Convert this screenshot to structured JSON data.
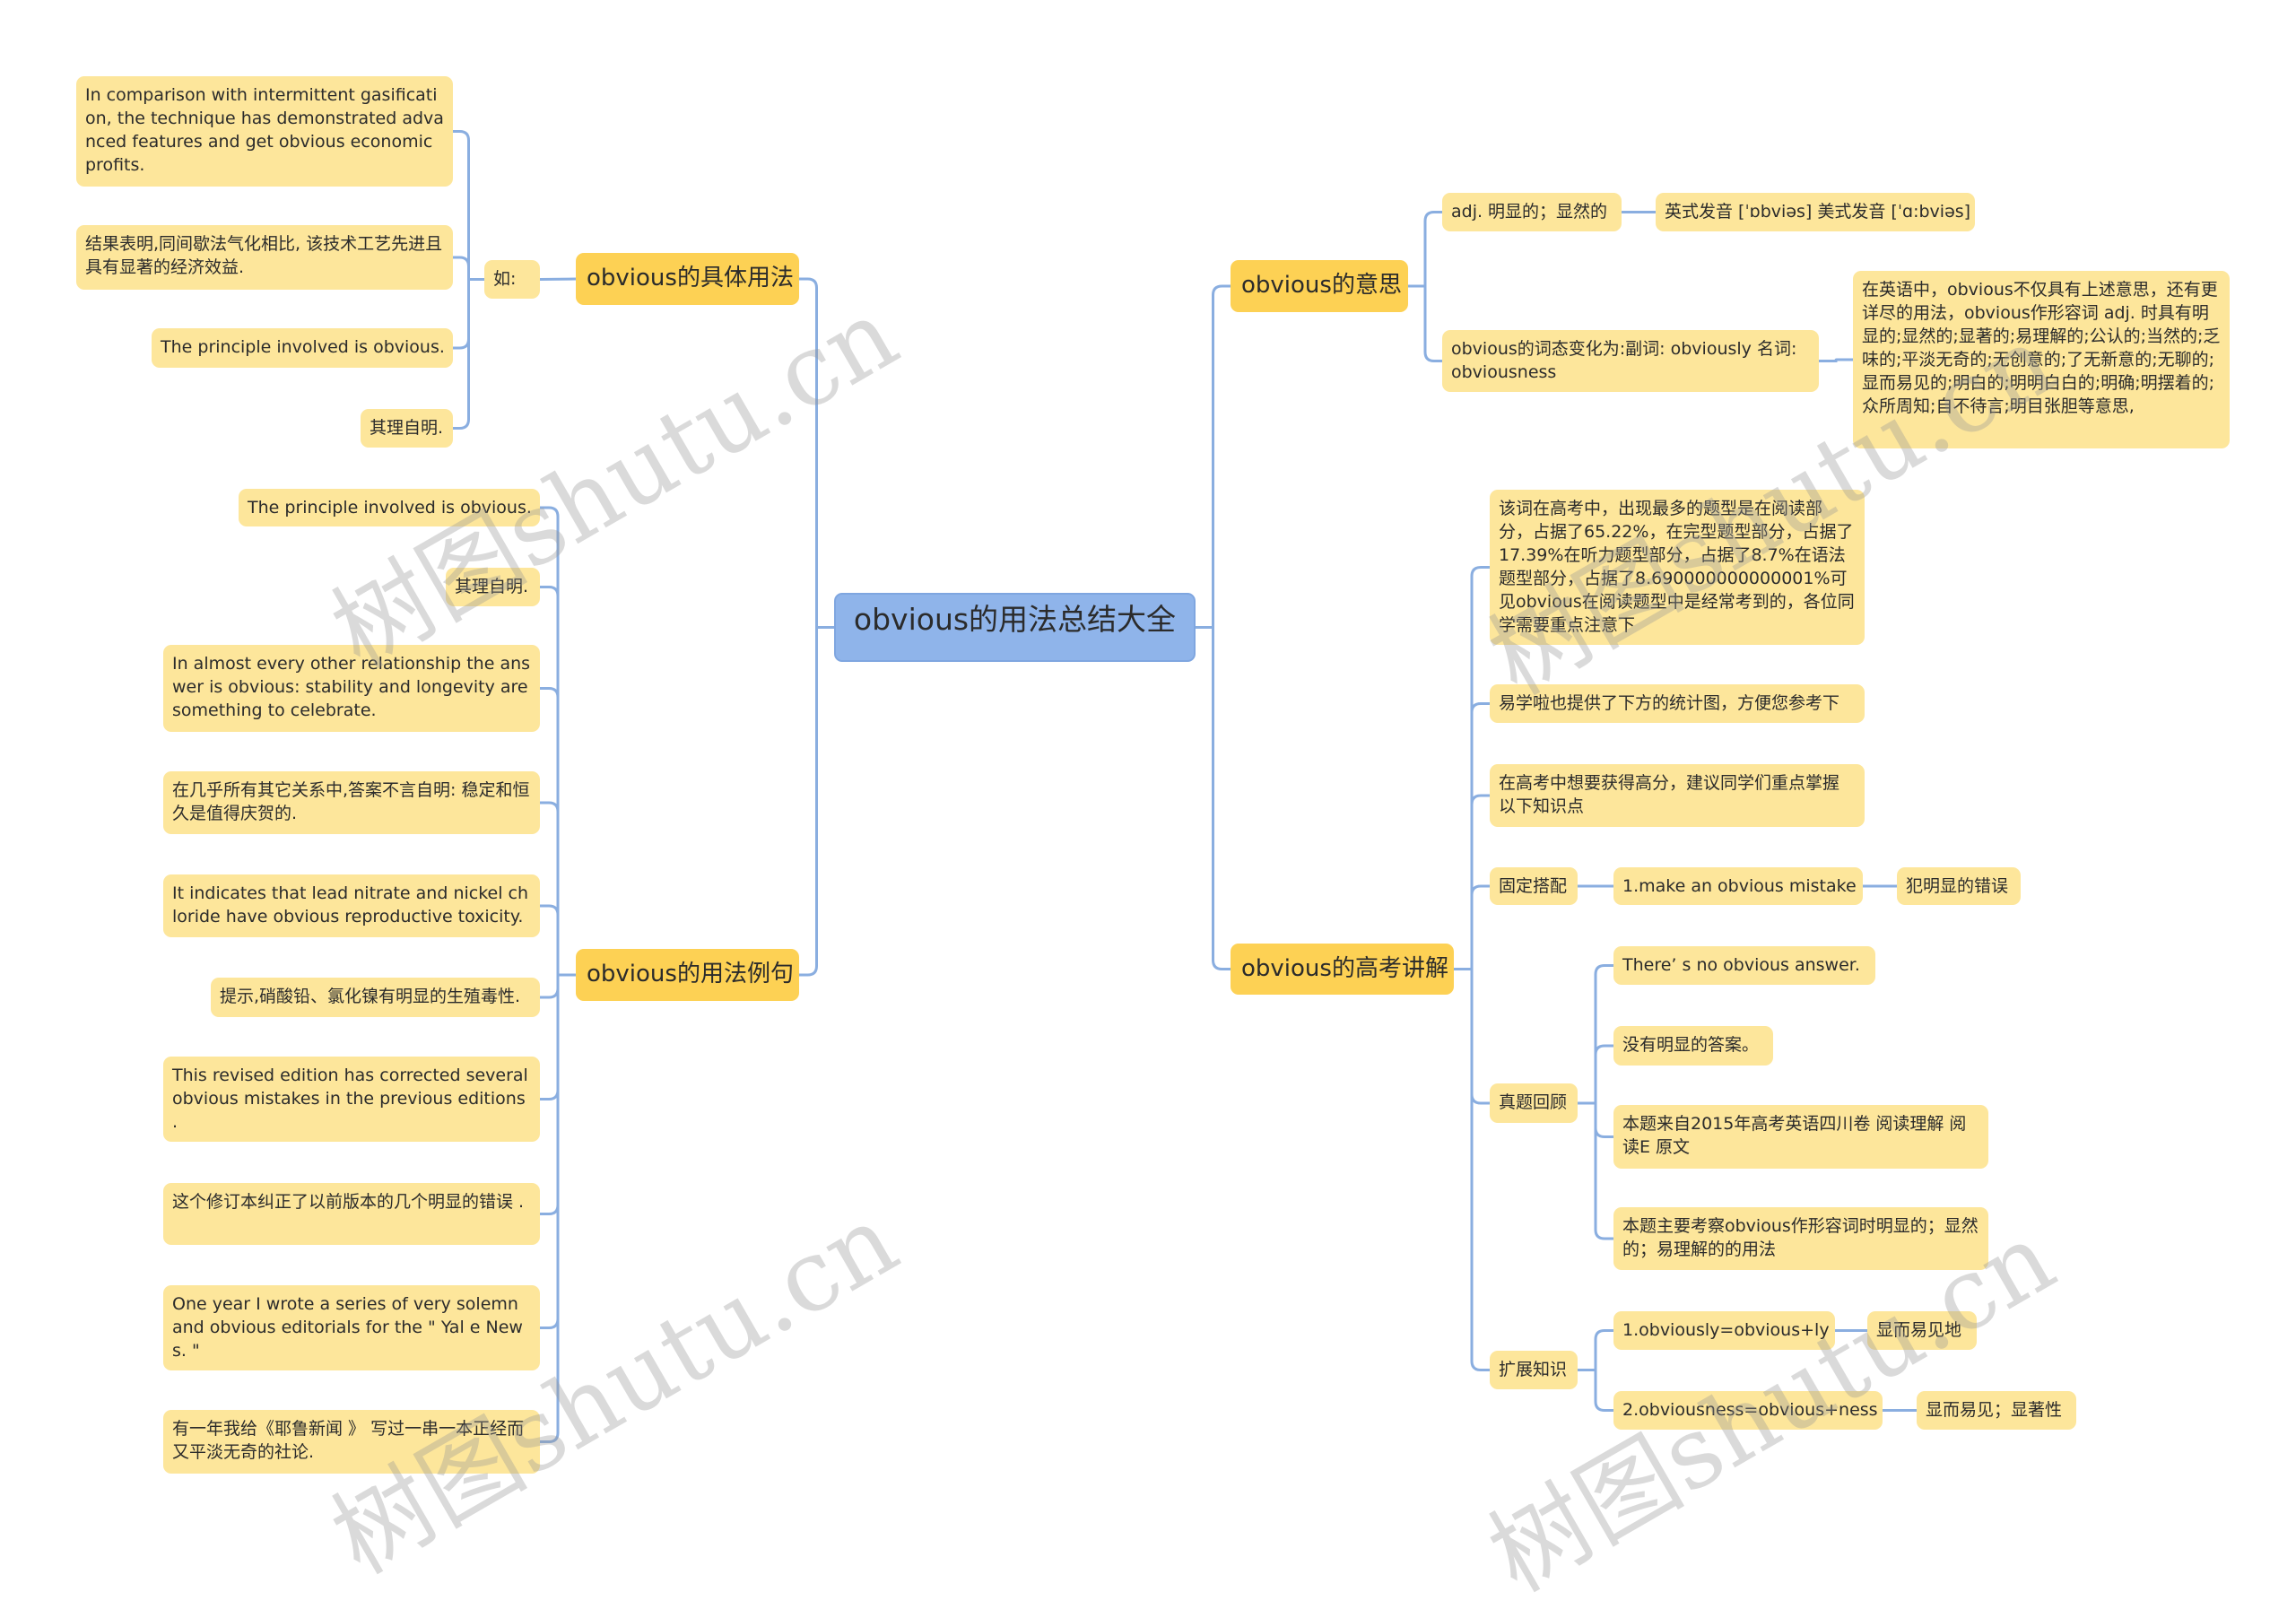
{
  "root": "obvious的用法总结大全",
  "usage": {
    "label": "obvious的具体用法",
    "example_label": "如:",
    "items": [
      "In comparison with intermittent gasification, the technique has demonstrated advanced features and get obvious economic profits.",
      "结果表明,同间歇法气化相比, 该技术工艺先进且具有显著的经济效益.",
      "The principle involved is obvious.",
      "其理自明."
    ]
  },
  "examples": {
    "label": "obvious的用法例句",
    "items": [
      "The principle involved is obvious.",
      "其理自明.",
      "In almost every other relationship the answer is obvious: stability and longevity are  something to celebrate.",
      "在几乎所有其它关系中,答案不言自明: 稳定和恒久是值得庆贺的.",
      "It indicates that lead nitrate and nickel chloride have obvious reproductive toxicity.",
      "提示,硝酸铅、氯化镍有明显的生殖毒性.",
      "This revised edition has corrected several obvious mistakes in the previous editions .",
      "这个修订本纠正了以前版本的几个明显的错误 .",
      "One year I wrote a series of very solemn and obvious editorials for the \" Yal e News. \"",
      "有一年我给《耶鲁新闻 》 写过一串一本正经而又平淡无奇的社论."
    ]
  },
  "meaning": {
    "label": "obvious的意思",
    "adj": "adj. 明显的；显然的",
    "pronunciation": "英式发音 [ˈɒbviəs] 美式发音 [ˈɑ:bviəs]",
    "forms": "obvious的词态变化为:副词: obviously 名词: obviousness",
    "detail": "在英语中，obvious不仅具有上述意思，还有更详尽的用法，obvious作形容词 adj. 时具有明显的;显然的;显著的;易理解的;公认的;当然的;乏味的;平淡无奇的;无创意的;了无新意的;无聊的;显而易见的;明白的;明明白白的;明确;明摆着的;众所周知;自不待言;明目张胆等意思,"
  },
  "gaokao": {
    "label": "obvious的高考讲解",
    "stats": "该词在高考中，出现最多的题型是在阅读部分，占据了65.22%，在完型题型部分，占据了17.39%在听力题型部分，占据了8.7%在语法题型部分，占据了8.690000000000001%可见obvious在阅读题型中是经常考到的，各位同学需要重点注意下",
    "chart_note": "易学啦也提供了下方的统计图，方便您参考下",
    "advice": "在高考中想要获得高分，建议同学们重点掌握以下知识点",
    "collocation": {
      "label": "固定搭配",
      "phrase": "1.make an obvious mistake",
      "meaning": "犯明显的错误"
    },
    "review": {
      "label": "真题回顾",
      "items": [
        "There’ s no obvious answer.",
        "没有明显的答案。",
        "本题来自2015年高考英语四川卷 阅读理解 阅读E 原文",
        "本题主要考察obvious作形容词时明显的；显然的；易理解的的用法"
      ]
    },
    "extension": {
      "label": "扩展知识",
      "items": [
        {
          "formula": "1.obviously=obvious+ly",
          "meaning": "显而易见地"
        },
        {
          "formula": "2.obviousness=obvious+ness",
          "meaning": "显而易见；显著性"
        }
      ]
    }
  },
  "watermark": "树图shutu.cn",
  "colors": {
    "root": "#8fb4ea",
    "branch": "#fdd154",
    "leaf": "#fde69b",
    "line": "#8aaee0"
  }
}
